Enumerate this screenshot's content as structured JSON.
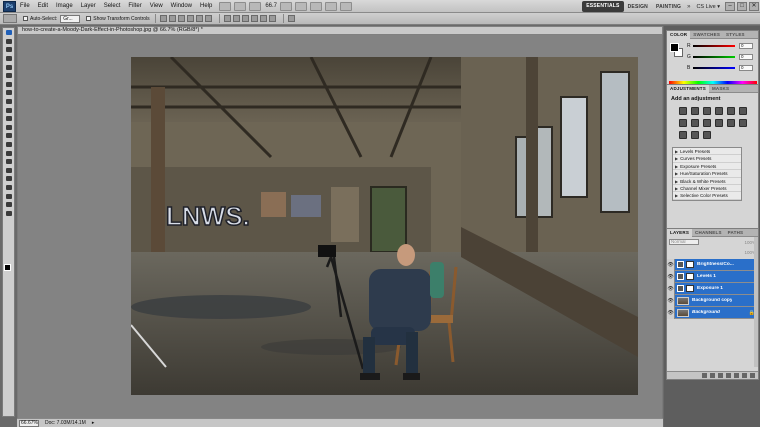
{
  "menubar": {
    "logo": "Ps",
    "menus": [
      "File",
      "Edit",
      "Image",
      "Layer",
      "Select",
      "Filter",
      "View",
      "Window",
      "Help"
    ],
    "zoom": "66.7",
    "workspaces": [
      "ESSENTIALS",
      "DESIGN",
      "PAINTING"
    ],
    "more": "»",
    "cs_live": "CS Live ▾",
    "window_controls": [
      "–",
      "□",
      "✕"
    ]
  },
  "options": {
    "auto_select_label": "Auto-Select:",
    "auto_select_value": "Gr...",
    "transform_label": "Show Transform Controls"
  },
  "document": {
    "tab_title": "how-to-create-a-Moody-Dark-Effect-in-Photoshop.jpg @ 66.7% (RGB/8*) *",
    "zoom_field": "66.67%",
    "doc_size": "Doc: 7.03M/14.1M",
    "status_arrow": "▸"
  },
  "color_panel": {
    "tabs": [
      "COLOR",
      "SWATCHES",
      "STYLES"
    ],
    "sliders": [
      {
        "label": "R",
        "value": "0"
      },
      {
        "label": "G",
        "value": "0"
      },
      {
        "label": "B",
        "value": "0"
      }
    ]
  },
  "adjustments_panel": {
    "tabs": [
      "ADJUSTMENTS",
      "MASKS"
    ],
    "title": "Add an adjustment",
    "presets": [
      "Levels Presets",
      "Curves Presets",
      "Exposure Presets",
      "Hue/Saturation Presets",
      "Black & White Presets",
      "Channel Mixer Presets",
      "Selective Color Presets"
    ]
  },
  "layers_panel": {
    "tabs": [
      "LAYERS",
      "CHANNELS",
      "PATHS"
    ],
    "blend_mode": "Normal",
    "opacity": "100%",
    "fill": "100%",
    "layers": [
      {
        "name": "Brightness/Co...",
        "type": "adjustment"
      },
      {
        "name": "Levels 1",
        "type": "adjustment"
      },
      {
        "name": "Exposure 1",
        "type": "adjustment"
      },
      {
        "name": "Background copy",
        "type": "image"
      },
      {
        "name": "Background",
        "type": "image",
        "italic": true
      }
    ],
    "eye": "👁",
    "lock": "🔒"
  },
  "colors": {
    "selection_blue": "#2a6fc9",
    "panel_gray": "#d5d5d5",
    "canvas_gray": "#838383"
  }
}
